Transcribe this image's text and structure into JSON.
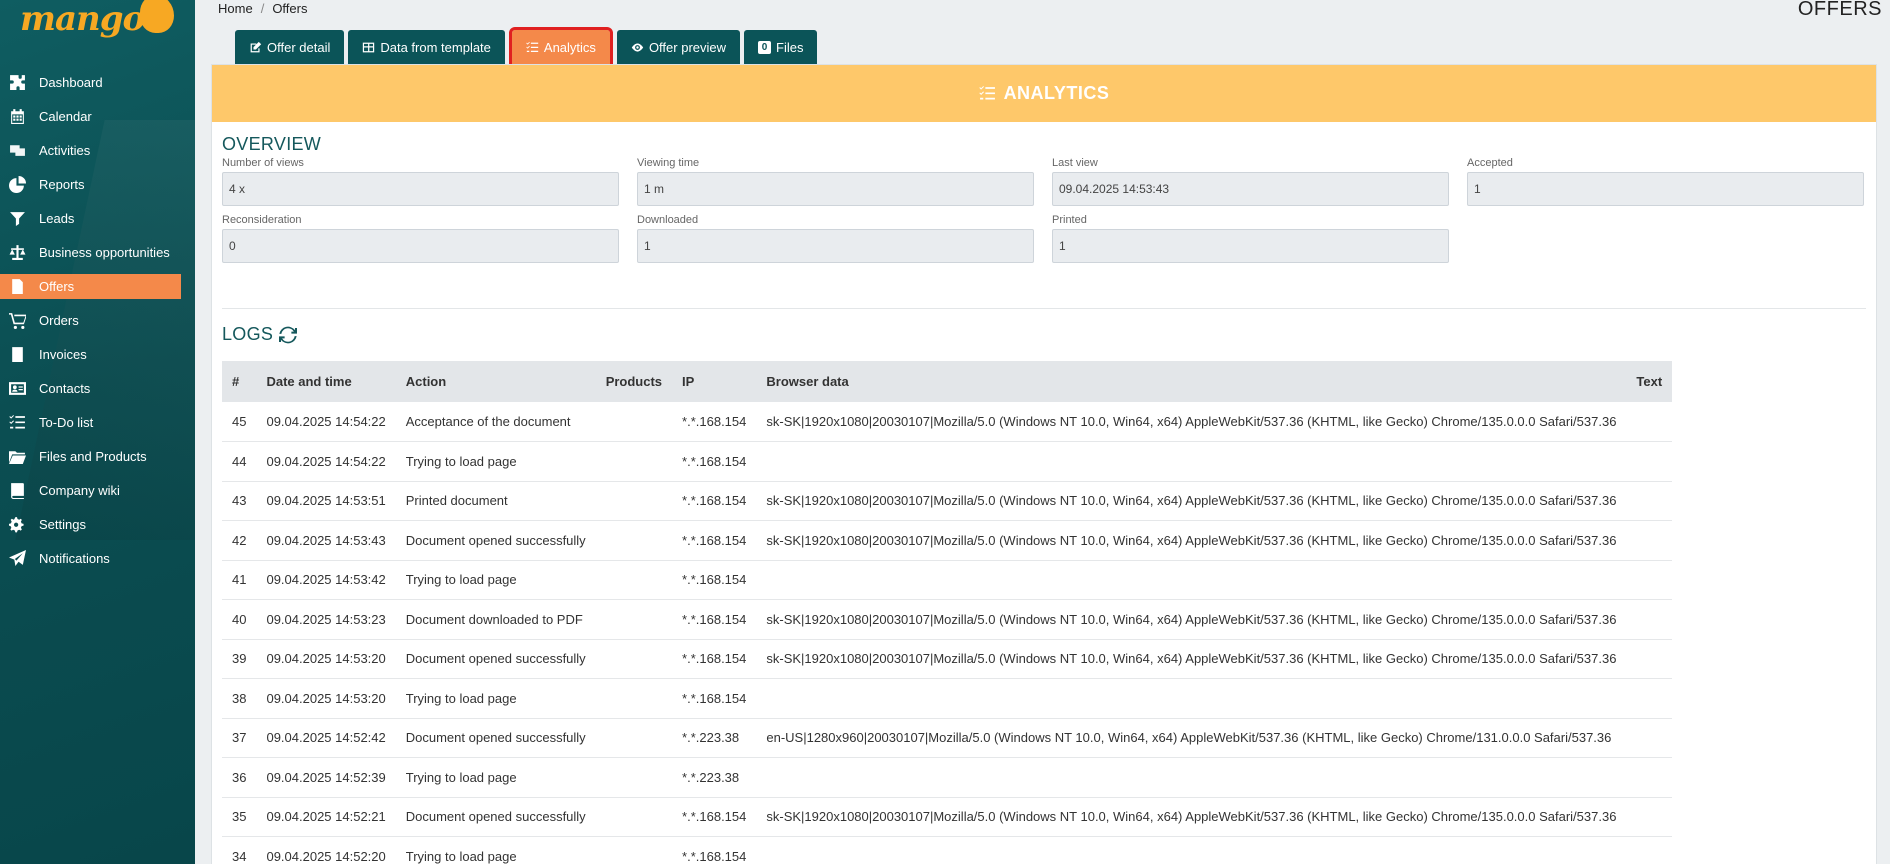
{
  "logo": {
    "text": "mango"
  },
  "sidebar": {
    "items": [
      {
        "label": "Dashboard",
        "icon": "puzzle-icon",
        "active": false
      },
      {
        "label": "Calendar",
        "icon": "calendar-icon",
        "active": false
      },
      {
        "label": "Activities",
        "icon": "activities-icon",
        "active": false
      },
      {
        "label": "Reports",
        "icon": "pie-chart-icon",
        "active": false
      },
      {
        "label": "Leads",
        "icon": "funnel-icon",
        "active": false
      },
      {
        "label": "Business opportunities",
        "icon": "scale-icon",
        "active": false
      },
      {
        "label": "Offers",
        "icon": "document-icon",
        "active": true
      },
      {
        "label": "Orders",
        "icon": "cart-icon",
        "active": false
      },
      {
        "label": "Invoices",
        "icon": "invoice-icon",
        "active": false
      },
      {
        "label": "Contacts",
        "icon": "contact-card-icon",
        "active": false
      },
      {
        "label": "To-Do list",
        "icon": "list-icon",
        "active": false
      },
      {
        "label": "Files and Products",
        "icon": "folder-icon",
        "active": false
      },
      {
        "label": "Company wiki",
        "icon": "book-icon",
        "active": false
      },
      {
        "label": "Settings",
        "icon": "gears-icon",
        "active": false
      },
      {
        "label": "Notifications",
        "icon": "paper-plane-icon",
        "active": false
      }
    ]
  },
  "breadcrumb": {
    "home": "Home",
    "separator": "/",
    "current": "Offers"
  },
  "page_title": "OFFERS",
  "tabs": [
    {
      "label": "Offer detail",
      "icon": "edit-icon",
      "active": false
    },
    {
      "label": "Data from template",
      "icon": "table-icon",
      "active": false
    },
    {
      "label": "Analytics",
      "icon": "list-check-icon",
      "active": true
    },
    {
      "label": "Offer preview",
      "icon": "eye-icon",
      "active": false
    },
    {
      "label": "Files",
      "icon": "file-badge-icon",
      "badge": "0",
      "active": false
    }
  ],
  "panel": {
    "header": "ANALYTICS",
    "overview_title": "OVERVIEW",
    "logs_title": "LOGS"
  },
  "overview": {
    "number_of_views": {
      "label": "Number of views",
      "value": "4 x"
    },
    "viewing_time": {
      "label": "Viewing time",
      "value": "1 m"
    },
    "last_view": {
      "label": "Last view",
      "value": "09.04.2025 14:53:43"
    },
    "accepted": {
      "label": "Accepted",
      "value": "1"
    },
    "reconsideration": {
      "label": "Reconsideration",
      "value": "0"
    },
    "downloaded": {
      "label": "Downloaded",
      "value": "1"
    },
    "printed": {
      "label": "Printed",
      "value": "1"
    }
  },
  "logs": {
    "columns": [
      "#",
      "Date and time",
      "Action",
      "Products",
      "IP",
      "Browser data",
      "Text"
    ],
    "rows": [
      [
        "45",
        "09.04.2025 14:54:22",
        "Acceptance of the document",
        "",
        "*.*.168.154",
        "sk-SK|1920x1080|20030107|Mozilla/5.0 (Windows NT 10.0, Win64, x64) AppleWebKit/537.36 (KHTML, like Gecko) Chrome/135.0.0.0 Safari/537.36",
        ""
      ],
      [
        "44",
        "09.04.2025 14:54:22",
        "Trying to load page",
        "",
        "*.*.168.154",
        "",
        ""
      ],
      [
        "43",
        "09.04.2025 14:53:51",
        "Printed document",
        "",
        "*.*.168.154",
        "sk-SK|1920x1080|20030107|Mozilla/5.0 (Windows NT 10.0, Win64, x64) AppleWebKit/537.36 (KHTML, like Gecko) Chrome/135.0.0.0 Safari/537.36",
        ""
      ],
      [
        "42",
        "09.04.2025 14:53:43",
        "Document opened successfully",
        "",
        "*.*.168.154",
        "sk-SK|1920x1080|20030107|Mozilla/5.0 (Windows NT 10.0, Win64, x64) AppleWebKit/537.36 (KHTML, like Gecko) Chrome/135.0.0.0 Safari/537.36",
        ""
      ],
      [
        "41",
        "09.04.2025 14:53:42",
        "Trying to load page",
        "",
        "*.*.168.154",
        "",
        ""
      ],
      [
        "40",
        "09.04.2025 14:53:23",
        "Document downloaded to PDF",
        "",
        "*.*.168.154",
        "sk-SK|1920x1080|20030107|Mozilla/5.0 (Windows NT 10.0, Win64, x64) AppleWebKit/537.36 (KHTML, like Gecko) Chrome/135.0.0.0 Safari/537.36",
        ""
      ],
      [
        "39",
        "09.04.2025 14:53:20",
        "Document opened successfully",
        "",
        "*.*.168.154",
        "sk-SK|1920x1080|20030107|Mozilla/5.0 (Windows NT 10.0, Win64, x64) AppleWebKit/537.36 (KHTML, like Gecko) Chrome/135.0.0.0 Safari/537.36",
        ""
      ],
      [
        "38",
        "09.04.2025 14:53:20",
        "Trying to load page",
        "",
        "*.*.168.154",
        "",
        ""
      ],
      [
        "37",
        "09.04.2025 14:52:42",
        "Document opened successfully",
        "",
        "*.*.223.38",
        "en-US|1280x960|20030107|Mozilla/5.0 (Windows NT 10.0, Win64, x64) AppleWebKit/537.36 (KHTML, like Gecko) Chrome/131.0.0.0 Safari/537.36",
        ""
      ],
      [
        "36",
        "09.04.2025 14:52:39",
        "Trying to load page",
        "",
        "*.*.223.38",
        "",
        ""
      ],
      [
        "35",
        "09.04.2025 14:52:21",
        "Document opened successfully",
        "",
        "*.*.168.154",
        "sk-SK|1920x1080|20030107|Mozilla/5.0 (Windows NT 10.0, Win64, x64) AppleWebKit/537.36 (KHTML, like Gecko) Chrome/135.0.0.0 Safari/537.36",
        ""
      ],
      [
        "34",
        "09.04.2025 14:52:20",
        "Trying to load page",
        "",
        "*.*.168.154",
        "",
        ""
      ]
    ]
  },
  "colors": {
    "sidebar_bg": "#0b5458",
    "accent_orange": "#f4894a",
    "panel_header": "#fec86a",
    "highlight_border": "#e02020",
    "section_title": "#15585c"
  }
}
